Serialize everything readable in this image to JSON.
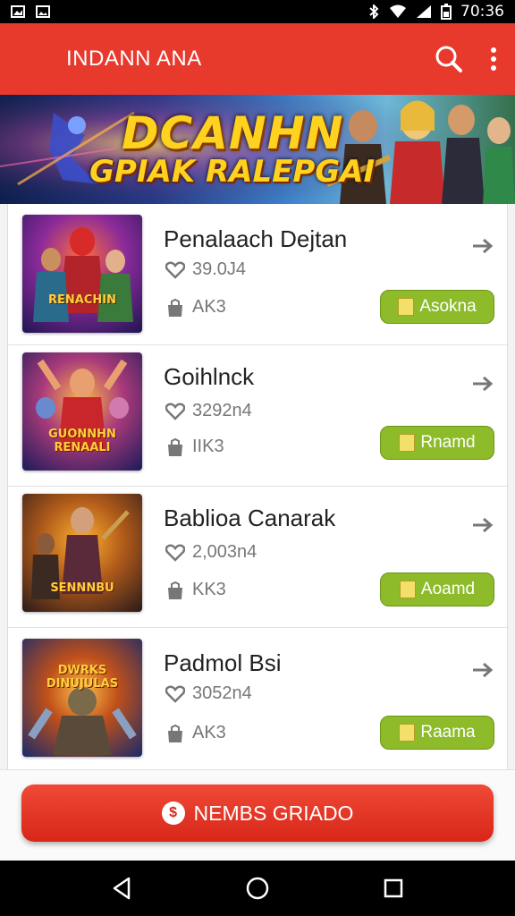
{
  "status_bar": {
    "time": "70:36",
    "icons": [
      "image-icon",
      "gallery-icon",
      "bluetooth-icon",
      "wifi-icon",
      "signal-icon",
      "battery-icon"
    ]
  },
  "app_bar": {
    "title": "INDANN ANA",
    "icons": [
      "menu-icon",
      "search-icon",
      "more-vertical-icon"
    ],
    "color": "#e8392d"
  },
  "banner": {
    "line1": "DCANHN",
    "line2": "GPIAK RALEPGAI"
  },
  "items": [
    {
      "title": "Penalaach Dejtan",
      "likes": "39.0J4",
      "meta2": "AK3",
      "button": "Asokna",
      "thumb_label": "RENACHIN"
    },
    {
      "title": "Goihlnck",
      "likes": "3292n4",
      "meta2": "IIK3",
      "button": "Rnamd",
      "thumb_label": "GUONNHN RENAALI"
    },
    {
      "title": "Bablioa Canarak",
      "likes": "2,003n4",
      "meta2": "KK3",
      "button": "Aoamd",
      "thumb_label": "SENNNBU"
    },
    {
      "title": "Padmol Bsi",
      "likes": "3052n4",
      "meta2": "AK3",
      "button": "Raama",
      "thumb_label": "DWRKS DINUJULAS"
    }
  ],
  "cta": {
    "label": "NEMBS GRIADO"
  },
  "nav": {
    "icons": [
      "back-icon",
      "home-icon",
      "recents-icon"
    ]
  },
  "colors": {
    "accent": "#e8392d",
    "button_green": "#8dbb2a"
  }
}
